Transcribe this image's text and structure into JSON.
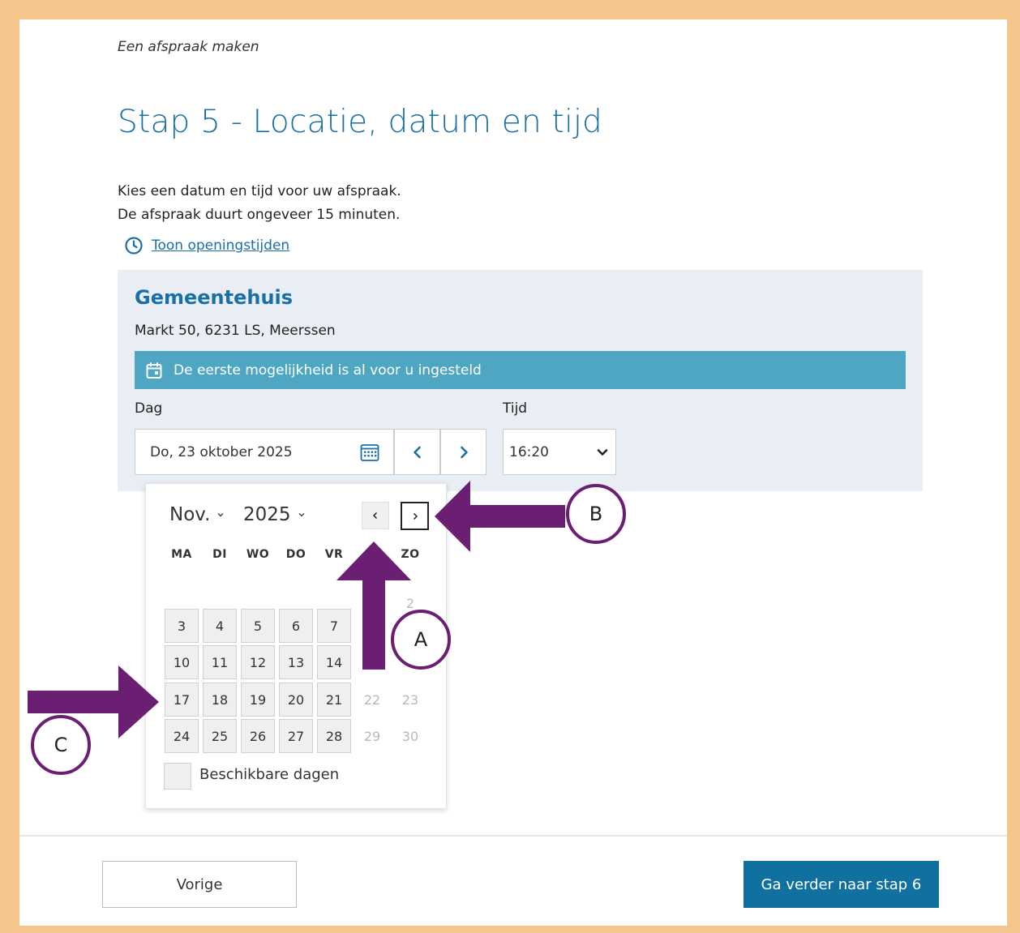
{
  "breadcrumb": "Een afspraak maken",
  "title": "Stap 5 - Locatie, datum en tijd",
  "intro": {
    "line1": "Kies een datum en tijd voor uw afspraak.",
    "line2": "De afspraak duurt ongeveer 15 minuten."
  },
  "opening_hours_link": "Toon openingstijden",
  "location": {
    "name": "Gemeentehuis",
    "address": "Markt 50, 6231 LS, Meerssen",
    "banner": "De eerste mogelijkheid is al voor u ingesteld"
  },
  "date_field": {
    "label": "Dag",
    "value": "Do, 23 oktober 2025"
  },
  "time_field": {
    "label": "Tijd",
    "value": "16:20"
  },
  "calendar": {
    "month": "Nov.",
    "year": "2025",
    "weekdays": [
      "MA",
      "DI",
      "WO",
      "DO",
      "VR",
      "",
      "ZO"
    ],
    "rows": [
      [
        {
          "d": "",
          "s": "empty"
        },
        {
          "d": "",
          "s": "empty"
        },
        {
          "d": "",
          "s": "empty"
        },
        {
          "d": "",
          "s": "empty"
        },
        {
          "d": "",
          "s": "empty"
        },
        {
          "d": "",
          "s": "empty"
        },
        {
          "d": "2",
          "s": "off"
        }
      ],
      [
        {
          "d": "3",
          "s": "avail"
        },
        {
          "d": "4",
          "s": "avail"
        },
        {
          "d": "5",
          "s": "avail"
        },
        {
          "d": "6",
          "s": "avail"
        },
        {
          "d": "7",
          "s": "avail"
        },
        {
          "d": "",
          "s": "empty"
        },
        {
          "d": "",
          "s": "empty"
        }
      ],
      [
        {
          "d": "10",
          "s": "avail"
        },
        {
          "d": "11",
          "s": "avail"
        },
        {
          "d": "12",
          "s": "avail"
        },
        {
          "d": "13",
          "s": "avail"
        },
        {
          "d": "14",
          "s": "avail"
        },
        {
          "d": "",
          "s": "empty"
        },
        {
          "d": "",
          "s": "empty"
        }
      ],
      [
        {
          "d": "17",
          "s": "avail"
        },
        {
          "d": "18",
          "s": "avail"
        },
        {
          "d": "19",
          "s": "avail"
        },
        {
          "d": "20",
          "s": "avail"
        },
        {
          "d": "21",
          "s": "avail"
        },
        {
          "d": "22",
          "s": "off"
        },
        {
          "d": "23",
          "s": "off"
        }
      ],
      [
        {
          "d": "24",
          "s": "avail"
        },
        {
          "d": "25",
          "s": "avail"
        },
        {
          "d": "26",
          "s": "avail"
        },
        {
          "d": "27",
          "s": "avail"
        },
        {
          "d": "28",
          "s": "avail"
        },
        {
          "d": "29",
          "s": "off"
        },
        {
          "d": "30",
          "s": "off"
        }
      ]
    ],
    "legend": "Beschikbare dagen"
  },
  "buttons": {
    "previous": "Vorige",
    "next": "Ga verder naar stap 6"
  },
  "annotations": {
    "a": "A",
    "b": "B",
    "c": "C"
  },
  "colors": {
    "accent": "#1a6fa6",
    "banner": "#4fa6c3",
    "primary_button": "#1070a0",
    "arrow": "#6a1f73",
    "frame": "#f5c68c"
  },
  "icons": {
    "clock": "clock-icon",
    "calendar": "calendar-icon",
    "calendar_banner": "calendar-event-icon"
  }
}
